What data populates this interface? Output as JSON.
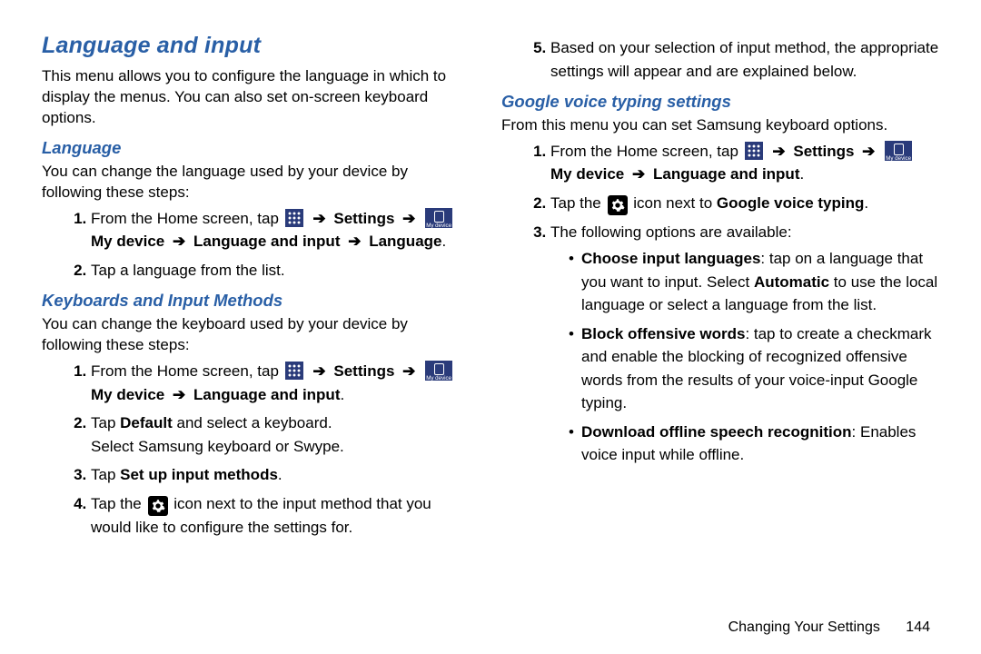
{
  "arrow": "➔",
  "labels": {
    "settings": "Settings",
    "mydevice": "My device",
    "langinput": "Language and input",
    "language": "Language"
  },
  "left": {
    "h1": "Language and input",
    "intro": "This menu allows you to configure the language in which to display the menus. You can also set on-screen keyboard options.",
    "sec1_h": "Language",
    "sec1_p": "You can change the language used by your device by following these steps:",
    "sec1_s1a": "From the Home screen, tap",
    "sec1_s2": "Tap a language from the list.",
    "sec2_h": "Keyboards and Input Methods",
    "sec2_p": "You can change the keyboard used by your device by following these steps:",
    "sec2_s1a": "From the Home screen, tap",
    "sec2_s2a": "Tap ",
    "sec2_s2b": "Default",
    "sec2_s2c": " and select a keyboard.",
    "sec2_s2d": "Select Samsung keyboard or Swype.",
    "sec2_s3a": "Tap ",
    "sec2_s3b": "Set up input methods",
    "sec2_s4a": "Tap the ",
    "sec2_s4b": " icon next to the input method that you would like to configure the settings for."
  },
  "right": {
    "s5": "Based on your selection of input method, the appropriate settings will appear and are explained below.",
    "h2": "Google voice typing settings",
    "p1": "From this menu you can set Samsung keyboard options.",
    "s1a": "From the Home screen, tap",
    "s2a": "Tap the ",
    "s2b": " icon next to ",
    "s2c": "Google voice typing",
    "s3": "The following options are available:",
    "b1a": "Choose input languages",
    "b1b": ": tap on a language that you want to input. Select ",
    "b1c": "Automatic",
    "b1d": " to use the local language or select a language from the list.",
    "b2a": "Block offensive words",
    "b2b": ": tap to create a checkmark and enable the blocking of recognized offensive words from the results of your voice-input Google typing.",
    "b3a": "Download offline speech recognition",
    "b3b": ": Enables voice input while offline."
  },
  "footer": {
    "chapter": "Changing Your Settings",
    "page": "144"
  }
}
